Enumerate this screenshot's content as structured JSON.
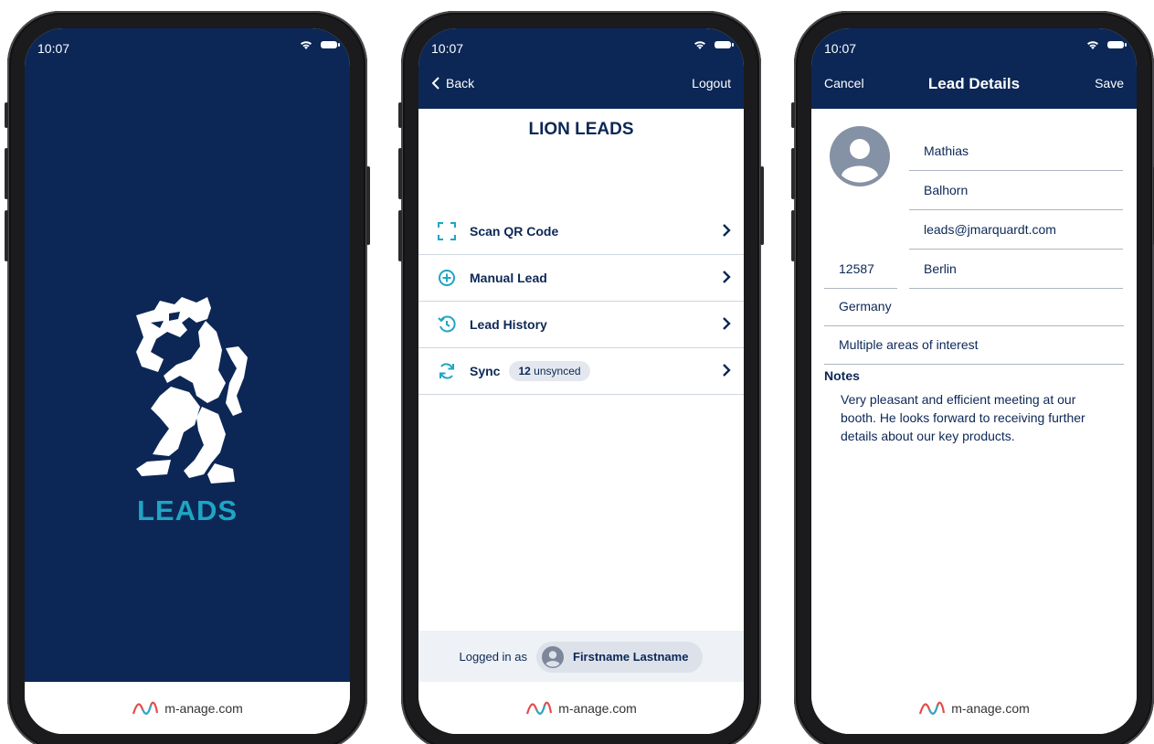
{
  "status": {
    "time": "10:07"
  },
  "footer": {
    "domain": "m-anage.com"
  },
  "colors": {
    "navy": "#0c2756",
    "accent": "#1fa5c4",
    "divider": "#cfd6df"
  },
  "splash": {
    "wordmark": "LEADS"
  },
  "home": {
    "back_label": "Back",
    "logout_label": "Logout",
    "title": "LION LEADS",
    "menu": [
      {
        "label": "Scan QR Code",
        "icon": "qr-scan-icon"
      },
      {
        "label": "Manual Lead",
        "icon": "plus-circle-icon"
      },
      {
        "label": "Lead History",
        "icon": "history-icon"
      },
      {
        "label": "Sync",
        "icon": "sync-icon",
        "badge_count": "12",
        "badge_text": "unsynced"
      }
    ],
    "logged_in_label": "Logged in as",
    "user_name": "Firstname Lastname"
  },
  "details": {
    "cancel_label": "Cancel",
    "title": "Lead Details",
    "save_label": "Save",
    "first_name": "Mathias",
    "last_name": "Balhorn",
    "email": "leads@jmarquardt.com",
    "zip": "12587",
    "city": "Berlin",
    "country": "Germany",
    "interest": "Multiple areas of interest",
    "notes_label": "Notes",
    "notes": "Very pleasant and efficient meeting at our booth. He looks forward to receiving further details about our key products."
  }
}
